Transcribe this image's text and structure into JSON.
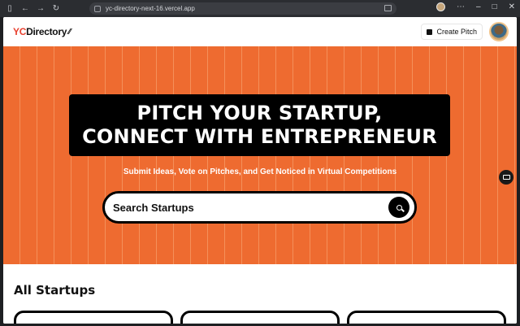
{
  "browser": {
    "url": "yc-directory-next-16.vercel.app"
  },
  "nav": {
    "logo_prefix": "YC",
    "logo_suffix": "Directory",
    "create_label": "Create Pitch"
  },
  "hero": {
    "tag_line1": "PITCH YOUR STARTUP,",
    "tag_line2": "CONNECT WITH ENTREPRENEUR",
    "subheading": "Submit Ideas, Vote on Pitches, and Get Noticed in Virtual Competitions",
    "search_placeholder": "Search Startups"
  },
  "startups": {
    "title": "All Startups"
  },
  "colors": {
    "accent": "#ee6b30",
    "brand_red": "#e8402f"
  }
}
